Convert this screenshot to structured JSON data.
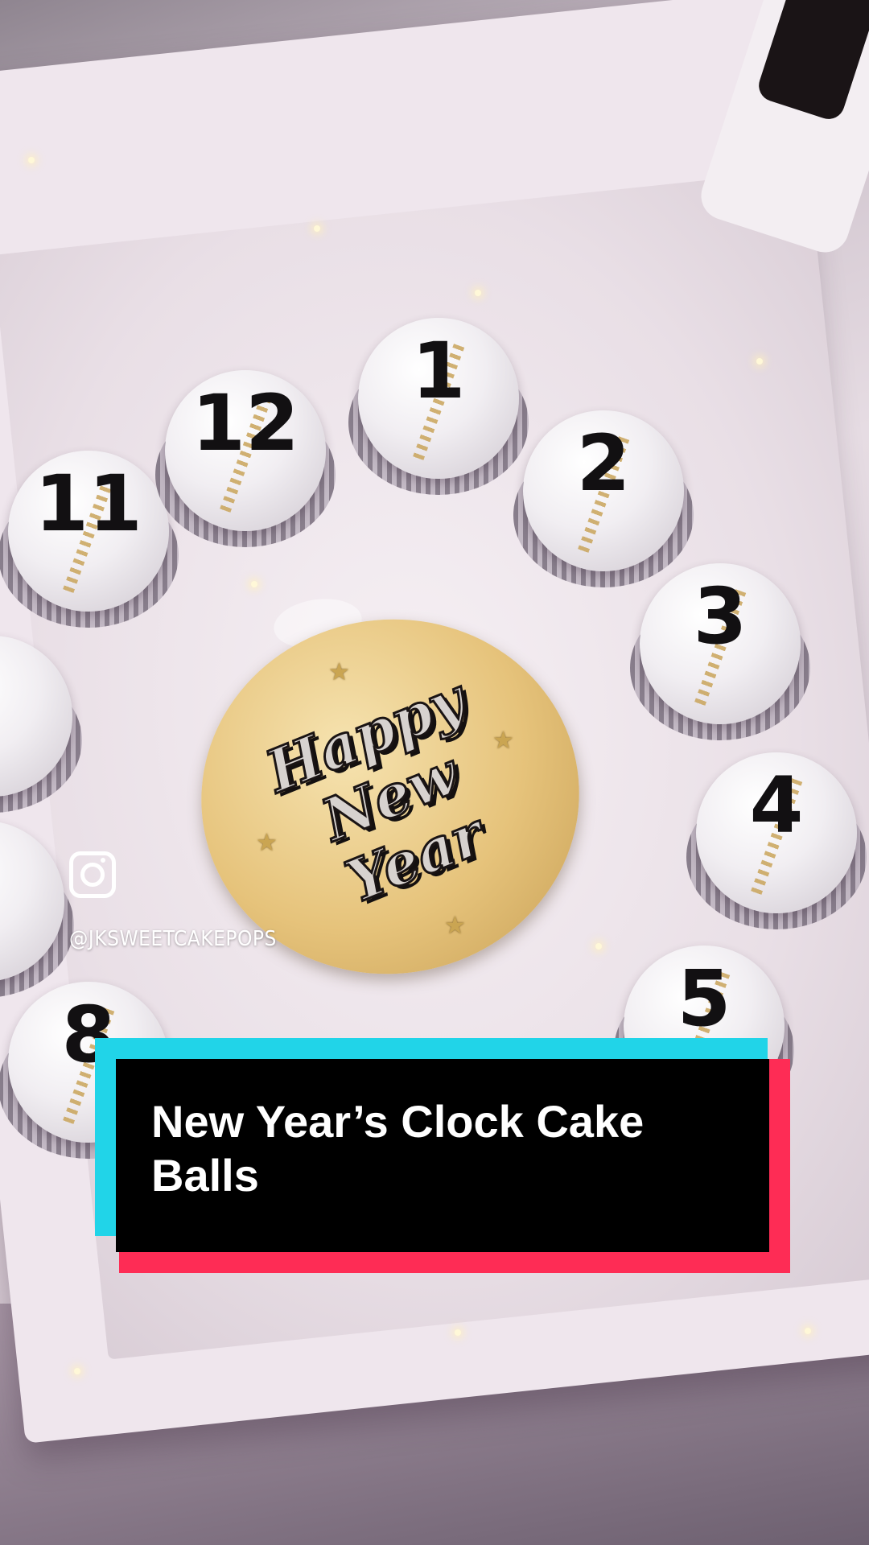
{
  "cake_pops": {
    "numbers": [
      "11",
      "12",
      "1",
      "2",
      "3",
      "4",
      "5",
      "8"
    ]
  },
  "plaque": {
    "line1": "Happy",
    "line2": "New",
    "line3": "Year"
  },
  "watermark": {
    "icon": "instagram-icon",
    "handle": "@JKSWEETCAKEPOPS"
  },
  "caption": {
    "title": "New Year’s Clock Cake Balls",
    "colors": {
      "background": "#000000",
      "text": "#ffffff",
      "accent_left": "#21d4e8",
      "accent_right": "#fe2c55"
    }
  }
}
